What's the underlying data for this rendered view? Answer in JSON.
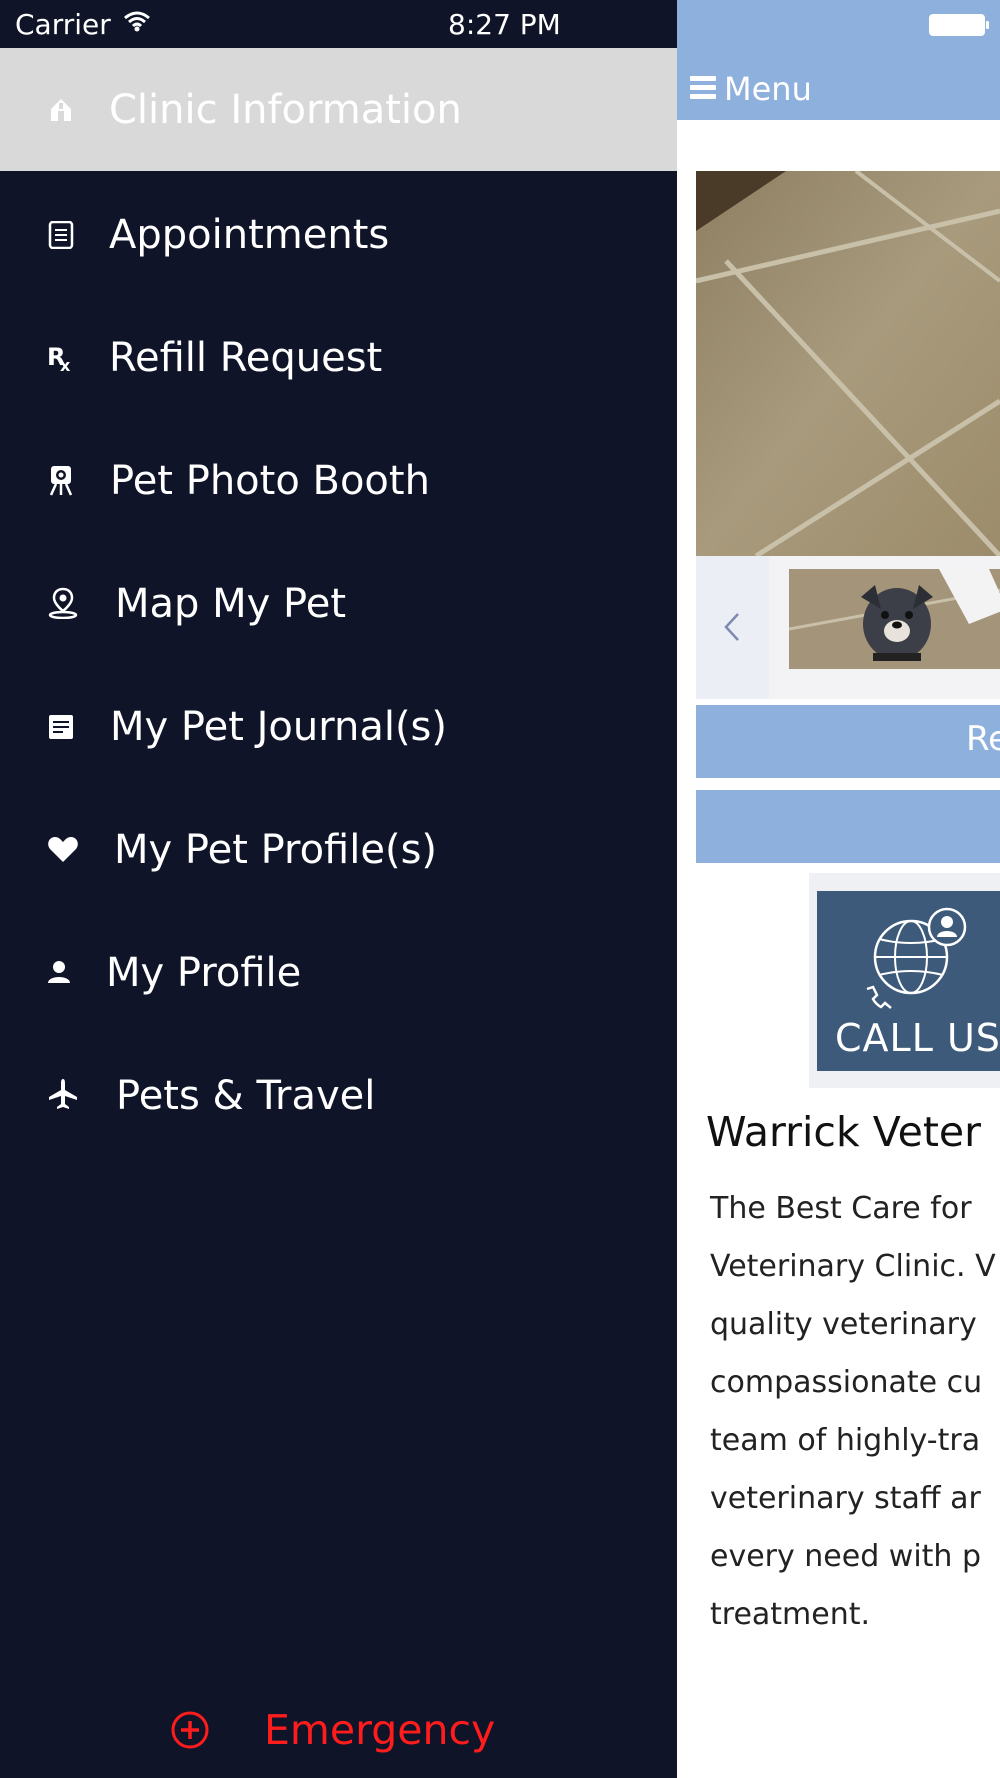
{
  "status_bar": {
    "carrier": "Carrier",
    "time": "8:27 PM"
  },
  "drawer": {
    "items": [
      {
        "label": "Clinic Information",
        "icon": "clinic-house-icon",
        "active": true
      },
      {
        "label": "Appointments",
        "icon": "list-document-icon"
      },
      {
        "label": "Refill Request",
        "icon": "prescription-rx-icon"
      },
      {
        "label": "Pet Photo Booth",
        "icon": "photo-booth-icon"
      },
      {
        "label": "Map My Pet",
        "icon": "map-pin-icon"
      },
      {
        "label": "My Pet Journal(s)",
        "icon": "journal-icon"
      },
      {
        "label": "My Pet Profile(s)",
        "icon": "heart-icon"
      },
      {
        "label": "My Profile",
        "icon": "person-icon"
      },
      {
        "label": "Pets & Travel",
        "icon": "airplane-icon"
      }
    ],
    "emergency": {
      "label": "Emergency",
      "icon": "plus-circle-icon",
      "color": "#ff1c1c"
    }
  },
  "content": {
    "nav": {
      "menu_label": "Menu",
      "bg_color": "#8eb0dc"
    },
    "primary_button_label": "Re",
    "call_label": "CALL US",
    "clinic_title": "Warrick Veter",
    "about_lines": [
      "The Best Care for",
      "Veterinary Clinic. V",
      "quality veterinary",
      "compassionate cu",
      "team of highly-tra",
      "veterinary staff ar",
      "every need with p",
      "treatment."
    ]
  }
}
